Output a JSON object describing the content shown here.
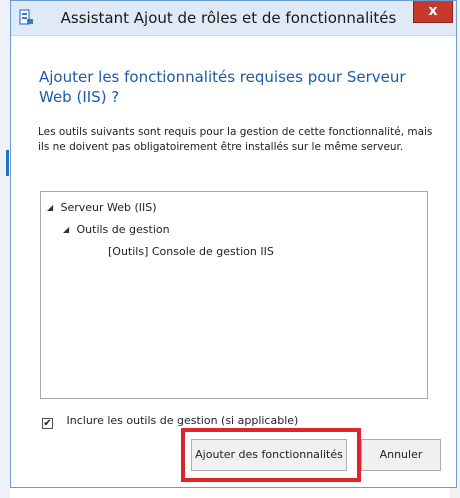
{
  "window": {
    "title": "Assistant Ajout de rôles et de fonctionnalités",
    "close_glyph": "x"
  },
  "dialog": {
    "heading": "Ajouter les fonctionnalités requises pour Serveur Web (IIS) ?",
    "description": "Les outils suivants sont requis pour la gestion de cette fonctionnalité, mais ils ne doivent pas obligatoirement être installés sur le même serveur."
  },
  "tree": {
    "items": [
      {
        "label": "Serveur Web (IIS)",
        "expanded": true
      },
      {
        "label": "Outils de gestion",
        "expanded": true
      },
      {
        "label": "[Outils] Console de gestion IIS",
        "expanded": false
      }
    ]
  },
  "include_tools": {
    "label": "Inclure les outils de gestion (si applicable)",
    "checked": true,
    "check_glyph": "✔"
  },
  "buttons": {
    "add_label": "Ajouter des fonctionnalités",
    "cancel_label": "Annuler"
  },
  "icons": {
    "app": "server-manager-icon",
    "expand": "expanded-triangle-icon",
    "close": "close-icon"
  },
  "colors": {
    "heading": "#1e5aa8",
    "titlebar": "#e0eaf7",
    "close": "#c63a2b",
    "highlight": "#e0242b"
  }
}
